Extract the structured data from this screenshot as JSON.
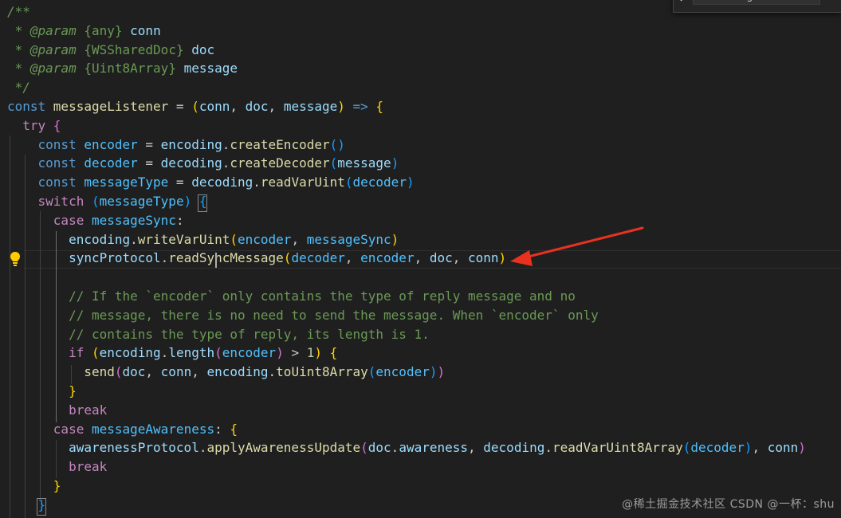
{
  "editor": {
    "find_widget": {
      "query": "on message"
    },
    "watermark": "@稀土掘金技术社区 CSDN @一杯：shu",
    "lines": [
      [
        {
          "t": "/**",
          "c": "c-comment c-italic"
        }
      ],
      [
        {
          "t": " * ",
          "c": "c-comment c-italic"
        },
        {
          "t": "@param",
          "c": "c-comment c-italic"
        },
        {
          "t": " ",
          "c": "c-comment"
        },
        {
          "t": "{",
          "c": "c-comment"
        },
        {
          "t": "any",
          "c": "c-comment"
        },
        {
          "t": "}",
          "c": "c-comment"
        },
        {
          "t": " conn",
          "c": "c-var"
        }
      ],
      [
        {
          "t": " * ",
          "c": "c-comment c-italic"
        },
        {
          "t": "@param",
          "c": "c-comment c-italic"
        },
        {
          "t": " ",
          "c": "c-comment"
        },
        {
          "t": "{",
          "c": "c-comment"
        },
        {
          "t": "WSSharedDoc",
          "c": "c-comment"
        },
        {
          "t": "}",
          "c": "c-comment"
        },
        {
          "t": " doc",
          "c": "c-var"
        }
      ],
      [
        {
          "t": " * ",
          "c": "c-comment c-italic"
        },
        {
          "t": "@param",
          "c": "c-comment c-italic"
        },
        {
          "t": " ",
          "c": "c-comment"
        },
        {
          "t": "{",
          "c": "c-comment"
        },
        {
          "t": "Uint8Array",
          "c": "c-comment"
        },
        {
          "t": "}",
          "c": "c-comment"
        },
        {
          "t": " message",
          "c": "c-var"
        }
      ],
      [
        {
          "t": " */",
          "c": "c-comment c-italic"
        }
      ],
      [
        {
          "t": "const ",
          "c": "c-keyword"
        },
        {
          "t": "messageListener",
          "c": "c-func"
        },
        {
          "t": " = ",
          "c": "c-plain"
        },
        {
          "t": "(",
          "c": "b1"
        },
        {
          "t": "conn",
          "c": "c-var"
        },
        {
          "t": ", ",
          "c": "c-plain"
        },
        {
          "t": "doc",
          "c": "c-var"
        },
        {
          "t": ", ",
          "c": "c-plain"
        },
        {
          "t": "message",
          "c": "c-var"
        },
        {
          "t": ")",
          "c": "b1"
        },
        {
          "t": " => ",
          "c": "c-keyword"
        },
        {
          "t": "{",
          "c": "b1"
        }
      ],
      [
        {
          "t": "  try ",
          "c": "c-control"
        },
        {
          "t": "{",
          "c": "b2"
        }
      ],
      [
        {
          "t": "    const ",
          "c": "c-keyword"
        },
        {
          "t": "encoder",
          "c": "c-const"
        },
        {
          "t": " = ",
          "c": "c-plain"
        },
        {
          "t": "encoding",
          "c": "c-var"
        },
        {
          "t": ".",
          "c": "c-plain"
        },
        {
          "t": "createEncoder",
          "c": "c-func"
        },
        {
          "t": "()",
          "c": "b3"
        }
      ],
      [
        {
          "t": "    const ",
          "c": "c-keyword"
        },
        {
          "t": "decoder",
          "c": "c-const"
        },
        {
          "t": " = ",
          "c": "c-plain"
        },
        {
          "t": "decoding",
          "c": "c-var"
        },
        {
          "t": ".",
          "c": "c-plain"
        },
        {
          "t": "createDecoder",
          "c": "c-func"
        },
        {
          "t": "(",
          "c": "b3"
        },
        {
          "t": "message",
          "c": "c-var"
        },
        {
          "t": ")",
          "c": "b3"
        }
      ],
      [
        {
          "t": "    const ",
          "c": "c-keyword"
        },
        {
          "t": "messageType",
          "c": "c-const"
        },
        {
          "t": " = ",
          "c": "c-plain"
        },
        {
          "t": "decoding",
          "c": "c-var"
        },
        {
          "t": ".",
          "c": "c-plain"
        },
        {
          "t": "readVarUint",
          "c": "c-func"
        },
        {
          "t": "(",
          "c": "b3"
        },
        {
          "t": "decoder",
          "c": "c-const"
        },
        {
          "t": ")",
          "c": "b3"
        }
      ],
      [
        {
          "t": "    switch ",
          "c": "c-control"
        },
        {
          "t": "(",
          "c": "b3"
        },
        {
          "t": "messageType",
          "c": "c-const"
        },
        {
          "t": ")",
          "c": "b3"
        },
        {
          "t": " ",
          "c": "c-plain"
        },
        {
          "t": "{",
          "c": "b3"
        }
      ],
      [
        {
          "t": "      case ",
          "c": "c-control"
        },
        {
          "t": "messageSync",
          "c": "c-const"
        },
        {
          "t": ":",
          "c": "c-plain"
        }
      ],
      [
        {
          "t": "        ",
          "c": "c-plain"
        },
        {
          "t": "encoding",
          "c": "c-var"
        },
        {
          "t": ".",
          "c": "c-plain"
        },
        {
          "t": "writeVarUint",
          "c": "c-func"
        },
        {
          "t": "(",
          "c": "b1"
        },
        {
          "t": "encoder",
          "c": "c-const"
        },
        {
          "t": ", ",
          "c": "c-plain"
        },
        {
          "t": "messageSync",
          "c": "c-const"
        },
        {
          "t": ")",
          "c": "b1"
        }
      ],
      [
        {
          "t": "        ",
          "c": "c-plain"
        },
        {
          "t": "syncProtocol",
          "c": "c-var"
        },
        {
          "t": ".",
          "c": "c-plain"
        },
        {
          "t": "readSyncMessage",
          "c": "c-func"
        },
        {
          "t": "(",
          "c": "b1"
        },
        {
          "t": "decoder",
          "c": "c-const"
        },
        {
          "t": ", ",
          "c": "c-plain"
        },
        {
          "t": "encoder",
          "c": "c-const"
        },
        {
          "t": ", ",
          "c": "c-plain"
        },
        {
          "t": "doc",
          "c": "c-var"
        },
        {
          "t": ", ",
          "c": "c-plain"
        },
        {
          "t": "conn",
          "c": "c-var"
        },
        {
          "t": ")",
          "c": "b1"
        }
      ],
      [],
      [
        {
          "t": "        // If the `encoder` only contains the type of reply message and no",
          "c": "c-comment"
        }
      ],
      [
        {
          "t": "        // message, there is no need to send the message. When `encoder` only",
          "c": "c-comment"
        }
      ],
      [
        {
          "t": "        // contains the type of reply, its length is 1.",
          "c": "c-comment"
        }
      ],
      [
        {
          "t": "        if ",
          "c": "c-control"
        },
        {
          "t": "(",
          "c": "b1"
        },
        {
          "t": "encoding",
          "c": "c-var"
        },
        {
          "t": ".",
          "c": "c-plain"
        },
        {
          "t": "length",
          "c": "c-var"
        },
        {
          "t": "(",
          "c": "b2"
        },
        {
          "t": "encoder",
          "c": "c-const"
        },
        {
          "t": ")",
          "c": "b2"
        },
        {
          "t": " > ",
          "c": "c-plain"
        },
        {
          "t": "1",
          "c": "c-number"
        },
        {
          "t": ")",
          "c": "b1"
        },
        {
          "t": " ",
          "c": "c-plain"
        },
        {
          "t": "{",
          "c": "b1"
        }
      ],
      [
        {
          "t": "          ",
          "c": "c-plain"
        },
        {
          "t": "send",
          "c": "c-func"
        },
        {
          "t": "(",
          "c": "b2"
        },
        {
          "t": "doc",
          "c": "c-var"
        },
        {
          "t": ", ",
          "c": "c-plain"
        },
        {
          "t": "conn",
          "c": "c-var"
        },
        {
          "t": ", ",
          "c": "c-plain"
        },
        {
          "t": "encoding",
          "c": "c-var"
        },
        {
          "t": ".",
          "c": "c-plain"
        },
        {
          "t": "toUint8Array",
          "c": "c-func"
        },
        {
          "t": "(",
          "c": "b3"
        },
        {
          "t": "encoder",
          "c": "c-const"
        },
        {
          "t": ")",
          "c": "b3"
        },
        {
          "t": ")",
          "c": "b2"
        }
      ],
      [
        {
          "t": "        }",
          "c": "b1"
        }
      ],
      [
        {
          "t": "        break",
          "c": "c-control"
        }
      ],
      [
        {
          "t": "      case ",
          "c": "c-control"
        },
        {
          "t": "messageAwareness",
          "c": "c-const"
        },
        {
          "t": ": ",
          "c": "c-plain"
        },
        {
          "t": "{",
          "c": "b1"
        }
      ],
      [
        {
          "t": "        ",
          "c": "c-plain"
        },
        {
          "t": "awarenessProtocol",
          "c": "c-var"
        },
        {
          "t": ".",
          "c": "c-plain"
        },
        {
          "t": "applyAwarenessUpdate",
          "c": "c-func"
        },
        {
          "t": "(",
          "c": "b2"
        },
        {
          "t": "doc",
          "c": "c-var"
        },
        {
          "t": ".",
          "c": "c-plain"
        },
        {
          "t": "awareness",
          "c": "c-var"
        },
        {
          "t": ", ",
          "c": "c-plain"
        },
        {
          "t": "decoding",
          "c": "c-var"
        },
        {
          "t": ".",
          "c": "c-plain"
        },
        {
          "t": "readVarUint8Array",
          "c": "c-func"
        },
        {
          "t": "(",
          "c": "b3"
        },
        {
          "t": "decoder",
          "c": "c-const"
        },
        {
          "t": ")",
          "c": "b3"
        },
        {
          "t": ", ",
          "c": "c-plain"
        },
        {
          "t": "conn",
          "c": "c-var"
        },
        {
          "t": ")",
          "c": "b2"
        }
      ],
      [
        {
          "t": "        break",
          "c": "c-control"
        }
      ],
      [
        {
          "t": "      }",
          "c": "b1"
        }
      ],
      [
        {
          "t": "    }",
          "c": "b3"
        }
      ]
    ],
    "colors": {
      "background": "#1f1f1f",
      "comment": "#6a9955",
      "keyword": "#569cd6",
      "control": "#c586c0",
      "function": "#dcdcaa",
      "variable": "#9cdcfe",
      "constant": "#4fc1ff",
      "number": "#b5cea8",
      "bracket1": "#ffd700",
      "bracket2": "#da70d6",
      "bracket3": "#179fff",
      "arrow": "#e8321f"
    }
  }
}
